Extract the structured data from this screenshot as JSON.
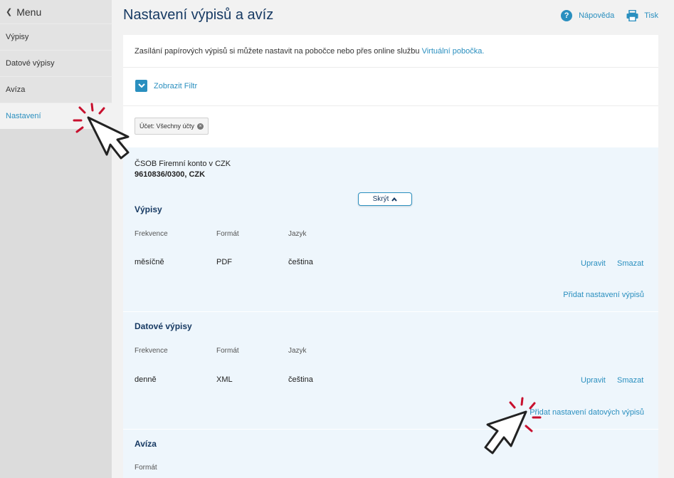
{
  "sidebar": {
    "menu_label": "Menu",
    "items": [
      {
        "label": "Výpisy"
      },
      {
        "label": "Datové výpisy"
      },
      {
        "label": "Avíza"
      },
      {
        "label": "Nastavení"
      }
    ]
  },
  "header": {
    "title": "Nastavení výpisů a avíz",
    "help_label": "Nápověda",
    "print_label": "Tisk"
  },
  "info": {
    "text": "Zasílání papírových výpisů si můžete nastavit na pobočce nebo přes online službu",
    "link": "Virtuální pobočka."
  },
  "filter": {
    "show_label": "Zobrazit Filtr",
    "chip_label": "Účet: Všechny účty"
  },
  "account": {
    "name": "ČSOB Firemní konto v CZK",
    "number": "9610836/0300, CZK",
    "hide_label": "Skrýt"
  },
  "statements": {
    "title": "Výpisy",
    "headers": {
      "frequency": "Frekvence",
      "format": "Formát",
      "language": "Jazyk"
    },
    "row": {
      "frequency": "měsíčně",
      "format": "PDF",
      "language": "čeština"
    },
    "edit_label": "Upravit",
    "delete_label": "Smazat",
    "add_label": "Přidat nastavení výpisů"
  },
  "data_statements": {
    "title": "Datové výpisy",
    "headers": {
      "frequency": "Frekvence",
      "format": "Formát",
      "language": "Jazyk"
    },
    "row": {
      "frequency": "denně",
      "format": "XML",
      "language": "čeština"
    },
    "edit_label": "Upravit",
    "delete_label": "Smazat",
    "add_label": "Přidat nastavení datových výpisů"
  },
  "advices": {
    "title": "Avíza",
    "headers": {
      "format": "Formát"
    }
  },
  "colors": {
    "accent": "#2a8fbf",
    "title": "#173a63",
    "cursor_spark": "#c8102e"
  }
}
